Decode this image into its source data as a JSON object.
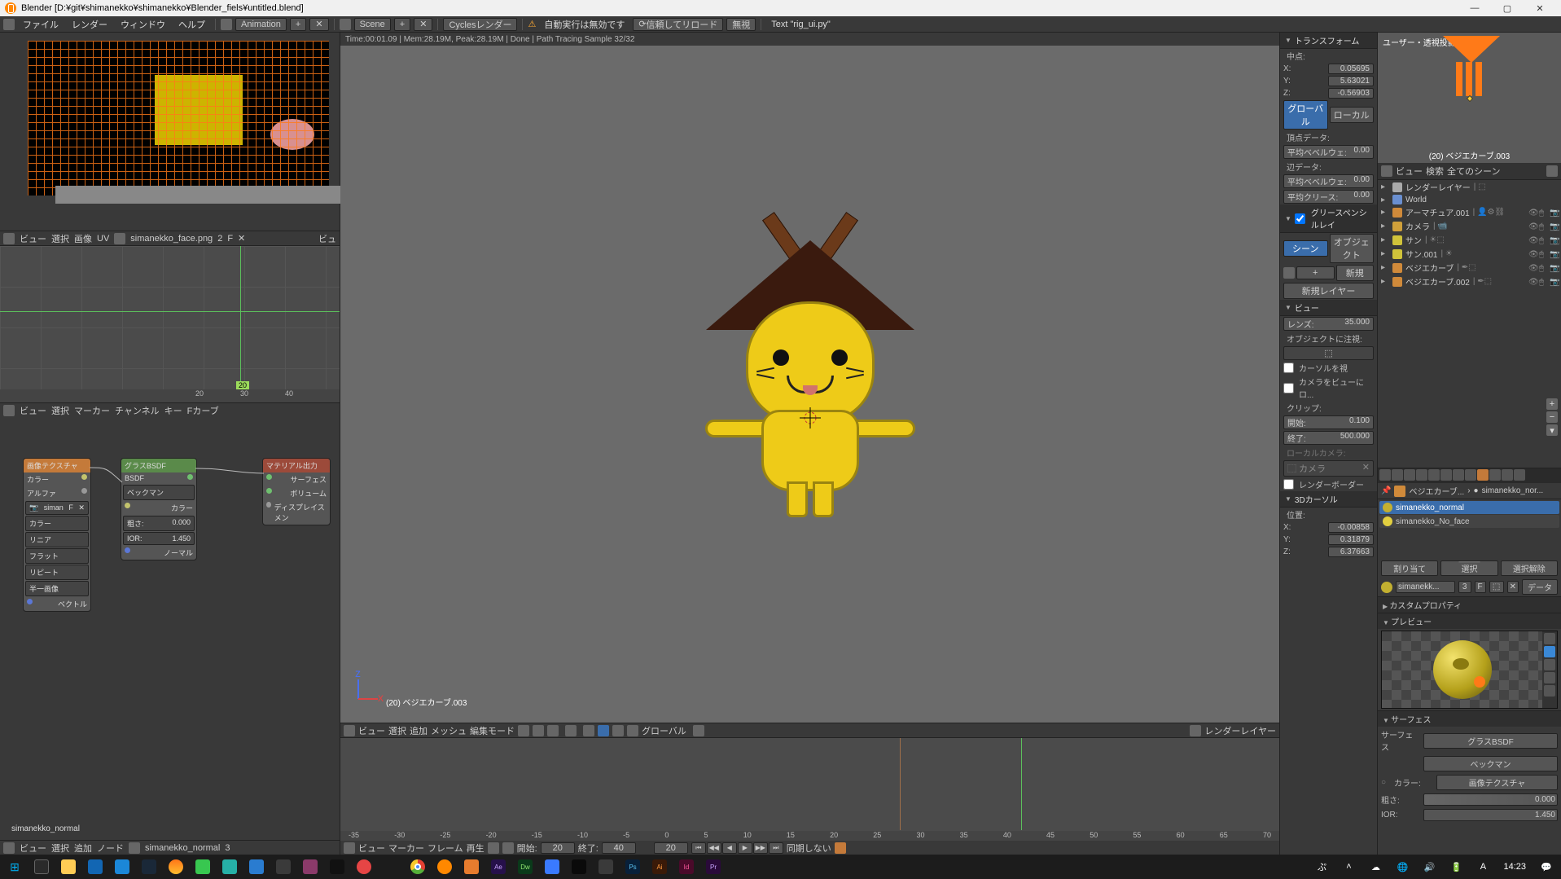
{
  "app": {
    "name": "Blender",
    "title_path": "[D:¥git¥shimanekko¥shimanekko¥Blender_fiels¥untitled.blend]"
  },
  "top_menu": {
    "file": "ファイル",
    "render": "レンダー",
    "window": "ウィンドウ",
    "help": "ヘルプ",
    "layout": "Animation",
    "scene": "Scene",
    "engine": "Cyclesレンダー",
    "auto_exec": "自動実行は無効です",
    "trust_reload": "信頼してリロード",
    "ignore": "無視",
    "text": "Text \"rig_ui.py\""
  },
  "uv": {
    "view": "ビュー",
    "select": "選択",
    "image": "画像",
    "uvs": "UV",
    "file": "simanekko_face.png",
    "users": "2",
    "fake": "F"
  },
  "graph": {
    "view": "ビュー",
    "select": "選択",
    "marker": "マーカー",
    "channel": "チャンネル",
    "key": "キー",
    "mode": "Fカーブ",
    "ticks": [
      "20",
      "30",
      "40"
    ],
    "frame": "20"
  },
  "nodes": {
    "image_tex": "画像テクスチャ",
    "color": "カラー",
    "alpha": "アルファ",
    "texfile": "siman",
    "fake": "F",
    "color_space": "カラー",
    "linear": "リニア",
    "flat": "フラット",
    "repeat": "リピート",
    "single": "半一画像",
    "vector": "ベクトル",
    "glass": "グラスBSDF",
    "bsdf": "BSDF",
    "beckmann": "ベックマン",
    "roughness": "粗さ:",
    "roughness_v": "0.000",
    "ior": "IOR:",
    "ior_v": "1.450",
    "normal": "ノーマル",
    "mat_out": "マテリアル出力",
    "surface": "サーフェス",
    "volume": "ボリューム",
    "disp": "ディスプレイスメン",
    "bottom_label": "simanekko_normal",
    "header": {
      "view": "ビュー",
      "select": "選択",
      "add": "追加",
      "node": "ノード",
      "mat": "simanekko_normal",
      "users": "3"
    }
  },
  "status_line": "Time:00:01.09 | Mem:28.19M, Peak:28.19M | Done | Path Tracing Sample 32/32",
  "viewport": {
    "object_label": "(20) ベジエカーブ.003",
    "axis_x": "x",
    "axis_z": "z",
    "header": {
      "view": "ビュー",
      "select": "選択",
      "add": "追加",
      "mesh": "メッシュ",
      "mode": "編集モード",
      "orient": "グローバル",
      "layers": "レンダーレイヤー"
    }
  },
  "timeline": {
    "ticks": [
      "-35",
      "-30",
      "-25",
      "-20",
      "-15",
      "-10",
      "-5",
      "0",
      "5",
      "10",
      "15",
      "20",
      "25",
      "30",
      "35",
      "40",
      "45",
      "50",
      "55",
      "60",
      "65",
      "70"
    ],
    "header": {
      "view": "ビュー",
      "marker": "マーカー",
      "frame": "フレーム",
      "play": "再生",
      "start_l": "開始:",
      "start_v": "20",
      "end_l": "終了:",
      "end_v": "40",
      "cur_v": "20",
      "sync": "同期しない"
    }
  },
  "npanel": {
    "transform": "トランスフォーム",
    "midpoint": "中点:",
    "x": "X:",
    "y": "Y:",
    "z": "Z:",
    "xv": "0.05695",
    "yv": "5.63021",
    "zv": "-0.56903",
    "global": "グローバル",
    "local": "ローカル",
    "vert_data": "頂点データ:",
    "avg_bevel": "平均ベベルウェ:",
    "avg_bevel_v": "0.00",
    "edge_data": "辺データ:",
    "avg_bevel2": "平均ベベルウェ:",
    "avg_bevel2_v": "0.00",
    "avg_crease": "平均クリース:",
    "avg_crease_v": "0.00",
    "gp": "グリースペンシルレイ",
    "gp_scene": "シーン",
    "gp_object": "オブジェクト",
    "gp_new": "新規",
    "gp_newlayer": "新規レイヤー",
    "view_h": "ビュー",
    "lens": "レンズ:",
    "lens_v": "35.000",
    "focus": "オブジェクトに注視:",
    "lock_cursor": "カーソルを視",
    "cam_to_view": "カメラをビューにロ...",
    "clip": "クリップ:",
    "clip_start": "開始:",
    "clip_start_v": "0.100",
    "clip_end": "終了:",
    "clip_end_v": "500.000",
    "local_cam": "ローカルカメラ:",
    "camera": "カメラ",
    "render_border": "レンダーボーダー",
    "cursor3d_h": "3Dカーソル",
    "loc": "位置:",
    "cx": "-0.00858",
    "cy": "0.31879",
    "cz": "6.37663"
  },
  "mini3d": {
    "persp": "ユーザー・透視投影",
    "label": "(20) ベジエカーブ.003"
  },
  "outliner": {
    "view": "ビュー",
    "search": "検索",
    "all_scenes": "全てのシーン",
    "render_layers": "レンダーレイヤー",
    "world": "World",
    "arm": "アーマチュア.001",
    "cam": "カメラ",
    "sun": "サン",
    "sun2": "サン.001",
    "bez": "ベジエカーブ",
    "bez2": "ベジエカーブ.002"
  },
  "props": {
    "crumb_obj": "ベジエカーブ...",
    "crumb_mat": "simanekko_nor...",
    "slot1": "simanekko_normal",
    "slot2": "simanekko_No_face",
    "assign": "割り当て",
    "select": "選択",
    "deselect": "選択解除",
    "matname": "simanekk...",
    "users": "3",
    "fake": "F",
    "data": "データ",
    "custom": "カスタムプロパティ",
    "preview": "プレビュー",
    "surface_h": "サーフェス",
    "surface_l": "サーフェス",
    "surface_v": "グラスBSDF",
    "beckmann": "ベックマン",
    "color_l": "カラー:",
    "color_v": "画像テクスチャ",
    "rough_l": "粗さ:",
    "rough_v": "0.000",
    "ior_l": "IOR:",
    "ior_v": "1.450"
  },
  "taskbar": {
    "clock": "14:23"
  }
}
